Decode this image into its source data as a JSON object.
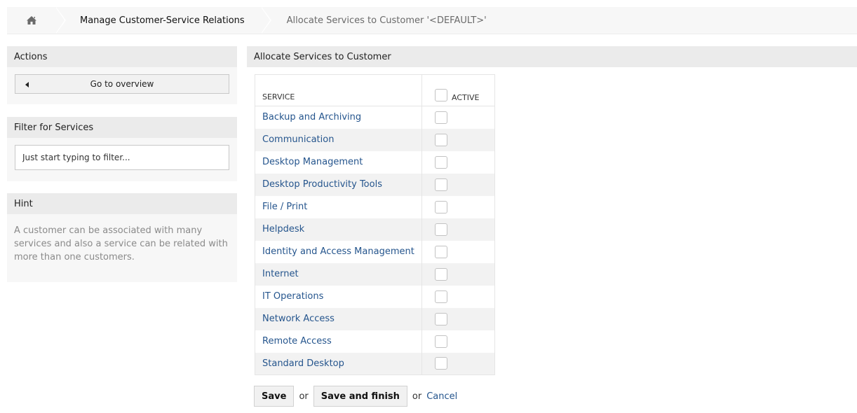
{
  "breadcrumb": {
    "home_icon": "home-icon",
    "items": [
      "Manage Customer-Service Relations",
      "Allocate Services to Customer '<DEFAULT>'"
    ]
  },
  "sidebar": {
    "actions_title": "Actions",
    "go_to_overview": "Go to overview",
    "filter_title": "Filter for Services",
    "filter_placeholder": "Just start typing to filter...",
    "hint_title": "Hint",
    "hint_text": "A customer can be associated with many services and also a service can be related with more than one customers."
  },
  "main": {
    "title": "Allocate Services to Customer",
    "columns": {
      "service": "SERVICE",
      "active": "ACTIVE"
    },
    "services": [
      "Backup and Archiving",
      "Communication",
      "Desktop Management",
      "Desktop Productivity Tools",
      "File / Print",
      "Helpdesk",
      "Identity and Access Management",
      "Internet",
      "IT Operations",
      "Network Access",
      "Remote Access",
      "Standard Desktop"
    ],
    "save": "Save",
    "or1": "or",
    "save_finish": "Save and finish",
    "or2": "or",
    "cancel": "Cancel"
  },
  "colors": {
    "link": "#25558d",
    "header_bg": "#ebebeb",
    "panel_bg": "#f7f7f7"
  }
}
